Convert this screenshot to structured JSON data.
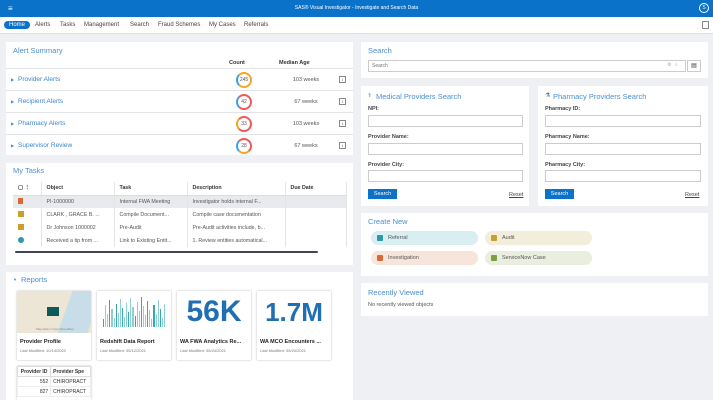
{
  "app": {
    "title": "SAS® Visual Investigator - Investigate and Search Data",
    "menu_icon": "hamburger-icon",
    "user_icon": "user-icon"
  },
  "nav": {
    "items": [
      "Home",
      "Alerts",
      "Tasks",
      "Management",
      "Search",
      "Fraud Schemes",
      "My Cases",
      "Referrals"
    ],
    "active": "Home"
  },
  "alert_summary": {
    "title": "Alert Summary",
    "col_count": "Count",
    "col_age": "Median Age",
    "rows": [
      {
        "label": "Provider Alerts",
        "count": "245",
        "age": "103 weeks"
      },
      {
        "label": "Recipient Alerts",
        "count": "42",
        "age": "67 weeks"
      },
      {
        "label": "Pharmacy Alerts",
        "count": "33",
        "age": "103 weeks"
      },
      {
        "label": "Supervisor Review",
        "count": "28",
        "age": "67 weeks"
      }
    ]
  },
  "tasks": {
    "title": "My Tasks",
    "columns": [
      "Object",
      "Task",
      "Description",
      "Due Date"
    ],
    "rows": [
      {
        "icon": "investigation-icon",
        "object": "PI-1000000",
        "task": "Internal FWA Meeting",
        "description": "Investigator holds internal F...",
        "due": ""
      },
      {
        "icon": "audit-icon",
        "object": "CLARK , GRACE B. ...",
        "task": "Compile Document...",
        "description": "Compile case documentation",
        "due": ""
      },
      {
        "icon": "audit-icon",
        "object": "Dr Johnson 1000002",
        "task": "Pre-Audit",
        "description": "Pre-Audit activities include, b...",
        "due": ""
      },
      {
        "icon": "referral-icon",
        "object": "Received a tip from ...",
        "task": "Link to Existing Entit...",
        "description": "1. Review entities automatical...",
        "due": ""
      }
    ]
  },
  "reports": {
    "title": "Reports",
    "cards": [
      {
        "name": "Provider Profile",
        "modified": "Last Modified: 10/14/2020",
        "map_credit": "Map data © OpenStreetMap"
      },
      {
        "name": "Redshift Data Report",
        "modified": "Last Modified: 05/12/2021"
      },
      {
        "name": "WA FWA Analytics Re...",
        "modified": "Last Modified: 05/24/2021",
        "kpi": "56K"
      },
      {
        "name": "WA MCO Encounters ...",
        "modified": "Last Modified: 05/20/2021",
        "kpi": "1.7M"
      }
    ],
    "table": {
      "columns": [
        "Provider ID",
        "Provider Spe"
      ],
      "rows": [
        [
          "552",
          "CHIROPRACT"
        ],
        [
          "827",
          "CHIROPRACT"
        ]
      ]
    }
  },
  "search": {
    "title": "Search",
    "placeholder": "Search"
  },
  "medical": {
    "title": "Medical Providers Search",
    "fields": [
      "NPI:",
      "Provider Name:",
      "Provider City:"
    ],
    "search": "Search",
    "reset": "Reset"
  },
  "pharmacy": {
    "title": "Pharmacy Providers Search",
    "fields": [
      "Pharmacy ID:",
      "Pharmacy Name:",
      "Pharmacy City:"
    ],
    "search": "Search",
    "reset": "Reset"
  },
  "create_new": {
    "title": "Create New",
    "items": [
      {
        "label": "Referral",
        "bg": "#d8eef2",
        "icon": "#2a9aa8"
      },
      {
        "label": "Audit",
        "bg": "#f3eedb",
        "icon": "#c9a030"
      },
      {
        "label": "Investigation",
        "bg": "#f7e4da",
        "icon": "#d86a35"
      },
      {
        "label": "ServiceNow Case",
        "bg": "#e9eede",
        "icon": "#7aa040"
      }
    ]
  },
  "recent": {
    "title": "Recently Viewed",
    "empty": "No recently viewed objects"
  },
  "colors": {
    "brand": "#0a72c8",
    "link": "#3a86cc"
  }
}
